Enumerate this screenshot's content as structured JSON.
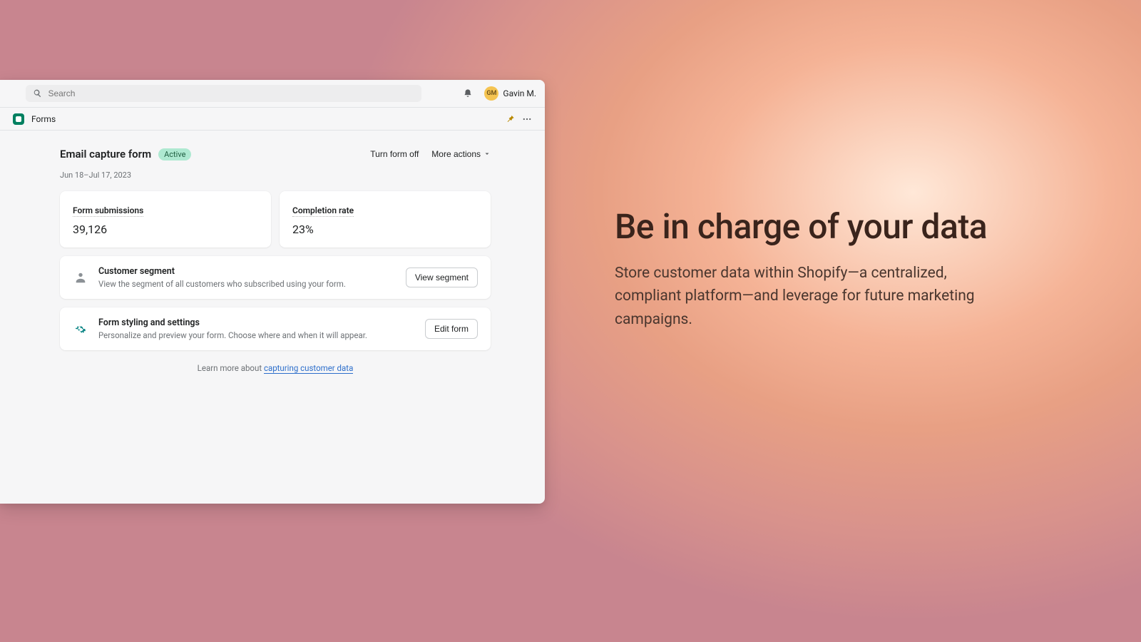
{
  "topbar": {
    "search_placeholder": "Search",
    "avatar_initials": "GM",
    "user_name": "Gavin M."
  },
  "subheader": {
    "title": "Forms"
  },
  "page": {
    "title": "Email capture form",
    "status": "Active",
    "turn_off_label": "Turn form off",
    "more_actions_label": "More actions",
    "date_range": "Jun 18–Jul 17, 2023"
  },
  "stats": {
    "submissions_label": "Form submissions",
    "submissions_value": "39,126",
    "completion_label": "Completion rate",
    "completion_value": "23%"
  },
  "segment_card": {
    "title": "Customer segment",
    "desc": "View the segment of all customers who subscribed using your form.",
    "button": "View segment"
  },
  "styling_card": {
    "title": "Form styling and settings",
    "desc": "Personalize and preview your form. Choose where and when it will appear.",
    "button": "Edit form"
  },
  "learn_more": {
    "prefix": "Learn more about ",
    "link_text": "capturing customer data"
  },
  "marketing": {
    "headline": "Be in charge of your data",
    "body": "Store customer data within Shopify—a centralized, compliant platform—and leverage for future marketing campaigns."
  }
}
